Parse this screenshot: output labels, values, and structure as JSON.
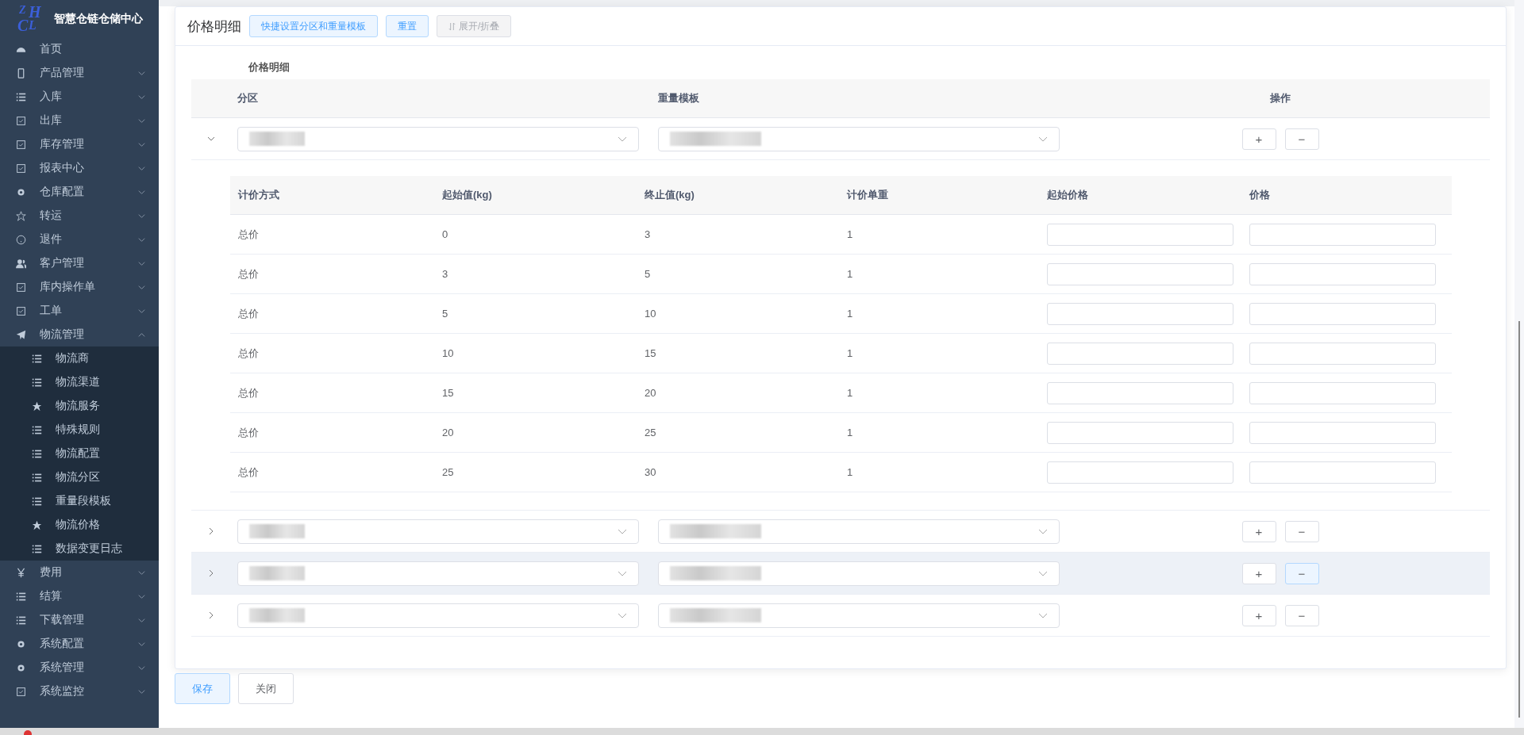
{
  "sidebar": {
    "logo_letters": [
      "Z",
      "H",
      "C",
      "L"
    ],
    "brand": "智慧仓链仓储中心",
    "items": [
      {
        "label": "首页"
      },
      {
        "label": "产品管理",
        "expandable": true,
        "expanded": false
      },
      {
        "label": "入库",
        "expandable": true,
        "expanded": false
      },
      {
        "label": "出库",
        "expandable": true,
        "expanded": false
      },
      {
        "label": "库存管理",
        "expandable": true,
        "expanded": false
      },
      {
        "label": "报表中心",
        "expandable": true,
        "expanded": false
      },
      {
        "label": "仓库配置",
        "expandable": true,
        "expanded": false
      },
      {
        "label": "转运",
        "expandable": true,
        "expanded": false
      },
      {
        "label": "退件",
        "expandable": true,
        "expanded": false
      },
      {
        "label": "客户管理",
        "expandable": true,
        "expanded": false
      },
      {
        "label": "库内操作单",
        "expandable": true,
        "expanded": false
      },
      {
        "label": "工单",
        "expandable": true,
        "expanded": false
      },
      {
        "label": "物流管理",
        "expandable": true,
        "expanded": true,
        "children": [
          {
            "label": "物流商"
          },
          {
            "label": "物流渠道"
          },
          {
            "label": "物流服务"
          },
          {
            "label": "特殊规则"
          },
          {
            "label": "物流配置"
          },
          {
            "label": "物流分区"
          },
          {
            "label": "重量段模板"
          },
          {
            "label": "物流价格"
          },
          {
            "label": "数据变更日志"
          }
        ]
      },
      {
        "label": "费用",
        "expandable": true,
        "expanded": false
      },
      {
        "label": "结算",
        "expandable": true,
        "expanded": false
      },
      {
        "label": "下载管理",
        "expandable": true,
        "expanded": false
      },
      {
        "label": "系统配置",
        "expandable": true,
        "expanded": false
      },
      {
        "label": "系统管理",
        "expandable": true,
        "expanded": false
      },
      {
        "label": "系统监控",
        "expandable": true,
        "expanded": false
      }
    ]
  },
  "panel": {
    "title": "价格明细",
    "buttons": [
      {
        "label": "快捷设置分区和重量模板",
        "disabled": false
      },
      {
        "label": "重置",
        "disabled": false
      },
      {
        "label": "展开/折叠",
        "disabled": true
      }
    ],
    "caption": "价格明细",
    "columns": [
      "分区",
      "重量模板",
      "操作"
    ],
    "rows": [
      {
        "expanded": true,
        "highlighted": false,
        "add": "+",
        "remove": "−",
        "detail": {
          "columns": [
            "计价方式",
            "起始值(kg)",
            "终止值(kg)",
            "计价单重",
            "起始价格",
            "价格"
          ],
          "rows": [
            [
              "总价",
              "0",
              "3",
              "1"
            ],
            [
              "总价",
              "3",
              "5",
              "1"
            ],
            [
              "总价",
              "5",
              "10",
              "1"
            ],
            [
              "总价",
              "10",
              "15",
              "1"
            ],
            [
              "总价",
              "15",
              "20",
              "1"
            ],
            [
              "总价",
              "20",
              "25",
              "1"
            ],
            [
              "总价",
              "25",
              "30",
              "1"
            ]
          ]
        }
      },
      {
        "expanded": false,
        "highlighted": false,
        "add": "+",
        "remove": "−"
      },
      {
        "expanded": false,
        "highlighted": true,
        "add": "+",
        "remove": "−"
      },
      {
        "expanded": false,
        "highlighted": false,
        "add": "+",
        "remove": "−"
      }
    ]
  },
  "footer": {
    "buttons": [
      {
        "label": "保存",
        "primary": true
      },
      {
        "label": "关闭",
        "primary": false
      }
    ]
  }
}
